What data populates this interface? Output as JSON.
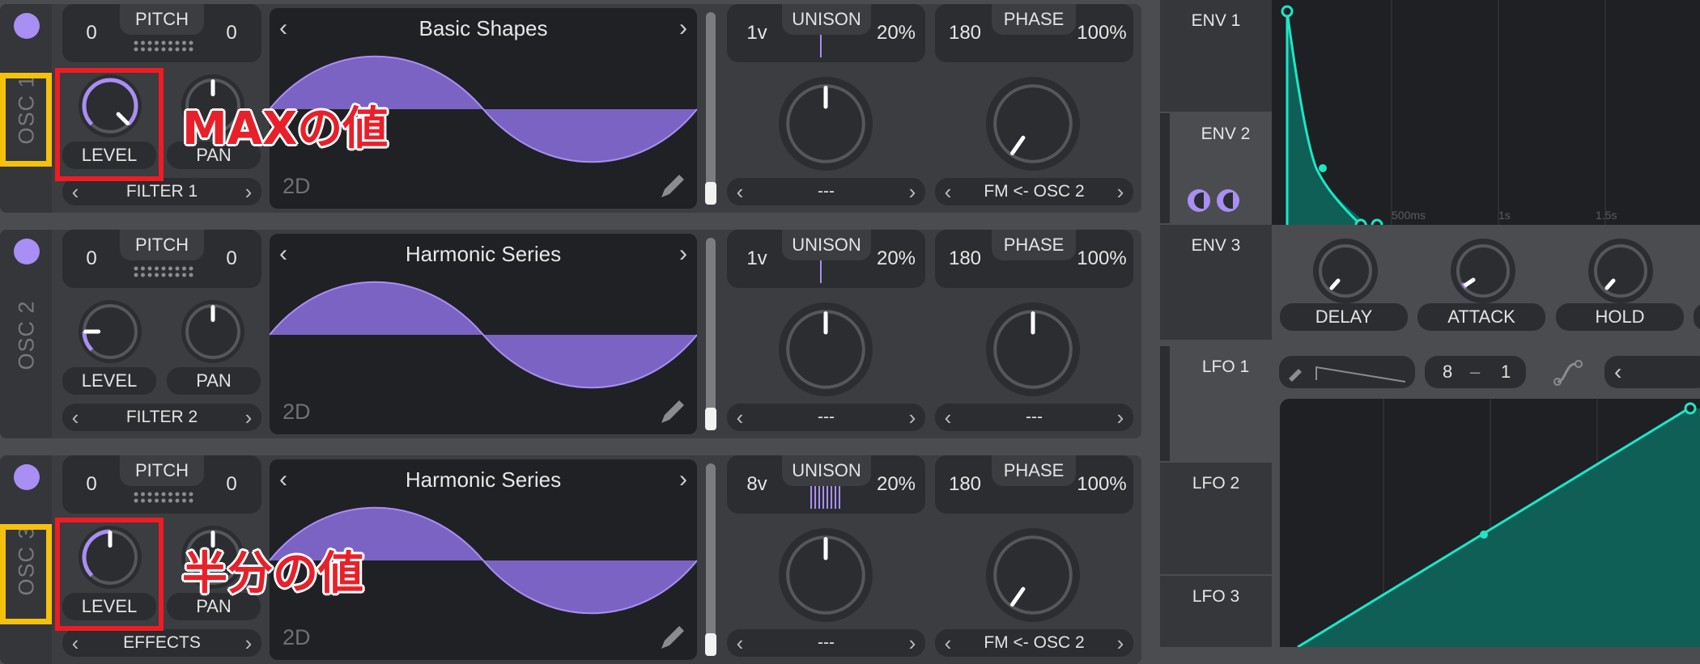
{
  "oscillators": [
    {
      "label": "OSC 1",
      "pitch_left": "0",
      "pitch_tab": "PITCH",
      "pitch_right": "0",
      "level_label": "LEVEL",
      "pan_label": "PAN",
      "dest_label": "FILTER 1",
      "wave_title": "Basic Shapes",
      "wave_dim": "2D",
      "unison_voices": "1v",
      "unison_tab": "UNISON",
      "unison_pct": "20%",
      "phase_val": "180",
      "phase_tab": "PHASE",
      "phase_pct": "100%",
      "left_sel": "---",
      "right_sel": "FM <- OSC 2"
    },
    {
      "label": "OSC 2",
      "pitch_left": "0",
      "pitch_tab": "PITCH",
      "pitch_right": "0",
      "level_label": "LEVEL",
      "pan_label": "PAN",
      "dest_label": "FILTER 2",
      "wave_title": "Harmonic Series",
      "wave_dim": "2D",
      "unison_voices": "1v",
      "unison_tab": "UNISON",
      "unison_pct": "20%",
      "phase_val": "180",
      "phase_tab": "PHASE",
      "phase_pct": "100%",
      "left_sel": "---",
      "right_sel": "---"
    },
    {
      "label": "OSC 3",
      "pitch_left": "0",
      "pitch_tab": "PITCH",
      "pitch_right": "0",
      "level_label": "LEVEL",
      "pan_label": "PAN",
      "dest_label": "EFFECTS",
      "wave_title": "Harmonic Series",
      "wave_dim": "2D",
      "unison_voices": "8v",
      "unison_tab": "UNISON",
      "unison_pct": "20%",
      "phase_val": "180",
      "phase_tab": "PHASE",
      "phase_pct": "100%",
      "left_sel": "---",
      "right_sel": "FM <- OSC 2"
    }
  ],
  "envelopes": {
    "tabs": [
      "ENV 1",
      "ENV 2",
      "ENV 3"
    ],
    "time_labels": [
      "500ms",
      "1s",
      "1.5s"
    ],
    "knob_labels": [
      "DELAY",
      "ATTACK",
      "HOLD"
    ]
  },
  "lfos": {
    "tabs": [
      "LFO 1",
      "LFO 2",
      "LFO 3"
    ],
    "tempo_num": "8",
    "tempo_sep": "–",
    "tempo_den": "1"
  },
  "annotations": {
    "max_value": "MAXの値",
    "half_value": "半分の値"
  },
  "colors": {
    "accent": "#a98ef3",
    "wave_fill": "#7b63c4",
    "env_teal": "#1ee6c6",
    "env_fill": "#0f5f57",
    "annotation_red": "#ef1c23",
    "annotation_yellow": "#f4c20d"
  }
}
